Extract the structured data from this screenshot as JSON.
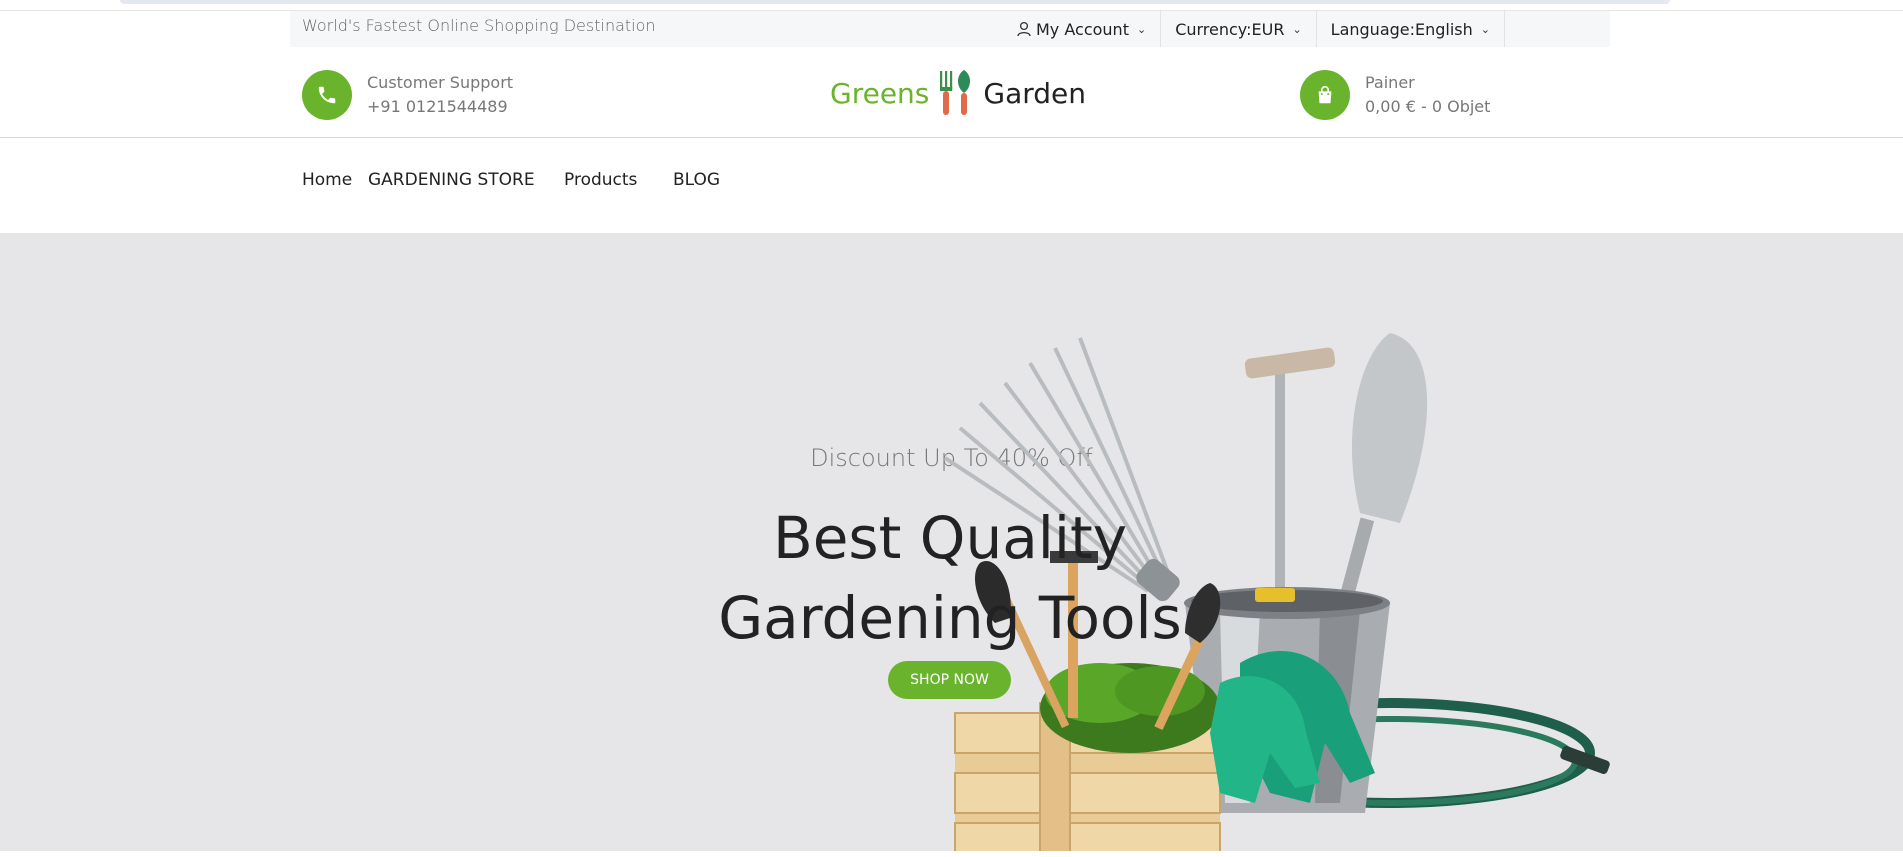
{
  "topbar": {
    "tagline": "World's Fastest Online Shopping Destination",
    "account_label": "My Account",
    "currency_label": "Currency:EUR",
    "language_label": "Language:English"
  },
  "header": {
    "support_title": "Customer Support",
    "support_phone": "+91 0121544489",
    "logo_left": "Greens",
    "logo_right": "Garden",
    "cart_title": "Painer",
    "cart_summary": "0,00 € - 0 Objet"
  },
  "nav": {
    "items": [
      "Home",
      "GARDENING STORE",
      "Products",
      "BLOG"
    ]
  },
  "hero": {
    "subtitle": "Discount Up To 40% Off",
    "title_line1": "Best Quality",
    "title_line2": "Gardening Tools",
    "button": "SHOP NOW"
  },
  "colors": {
    "accent": "#6ab42d",
    "hero_bg": "#e6e6e8"
  },
  "icons": [
    "user-icon",
    "chevron-down-icon",
    "phone-icon",
    "shopping-bag-icon",
    "logo-tools-icon"
  ]
}
